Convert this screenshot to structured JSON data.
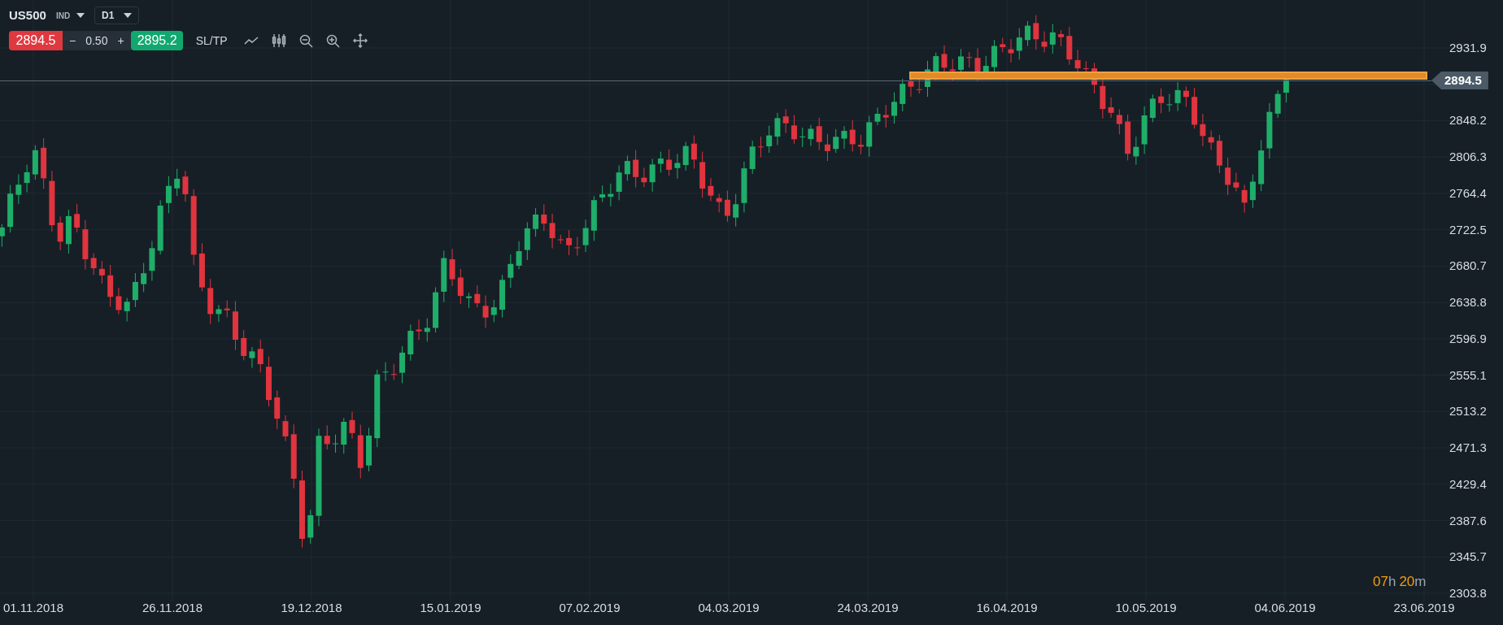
{
  "toolbar": {
    "symbol": "US500",
    "symbol_type": "IND",
    "timeframe": "D1",
    "bid": "2894.5",
    "spread_minus": "−",
    "spread": "0.50",
    "spread_plus": "+",
    "ask": "2895.2",
    "sl_tp": "SL/TP"
  },
  "price_axis": {
    "ticks": [
      "2931.9",
      "2848.2",
      "2806.3",
      "2764.4",
      "2722.5",
      "2680.7",
      "2638.8",
      "2596.9",
      "2555.1",
      "2513.2",
      "2471.3",
      "2429.4",
      "2387.6",
      "2345.7",
      "2303.8"
    ],
    "current_price": "2894.5"
  },
  "time_axis": {
    "ticks": [
      "01.11.2018",
      "26.11.2018",
      "19.12.2018",
      "15.01.2019",
      "07.02.2019",
      "04.03.2019",
      "24.03.2019",
      "16.04.2019",
      "10.05.2019",
      "04.06.2019",
      "23.06.2019"
    ]
  },
  "countdown": {
    "hours": "07",
    "hours_unit": "h",
    "minutes": "20",
    "minutes_unit": "m"
  }
}
